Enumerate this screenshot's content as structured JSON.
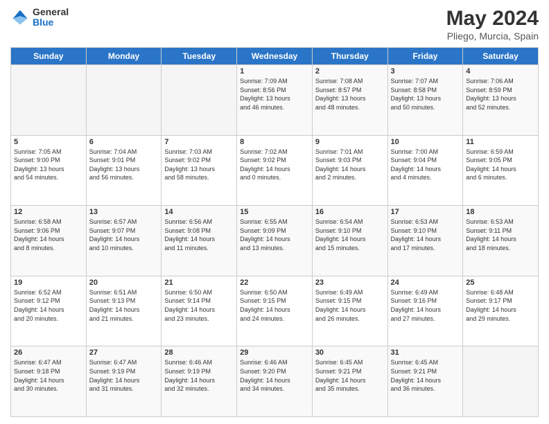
{
  "logo": {
    "general": "General",
    "blue": "Blue"
  },
  "header": {
    "title": "May 2024",
    "subtitle": "Pliego, Murcia, Spain"
  },
  "weekdays": [
    "Sunday",
    "Monday",
    "Tuesday",
    "Wednesday",
    "Thursday",
    "Friday",
    "Saturday"
  ],
  "weeks": [
    [
      {
        "day": "",
        "info": ""
      },
      {
        "day": "",
        "info": ""
      },
      {
        "day": "",
        "info": ""
      },
      {
        "day": "1",
        "info": "Sunrise: 7:09 AM\nSunset: 8:56 PM\nDaylight: 13 hours\nand 46 minutes."
      },
      {
        "day": "2",
        "info": "Sunrise: 7:08 AM\nSunset: 8:57 PM\nDaylight: 13 hours\nand 48 minutes."
      },
      {
        "day": "3",
        "info": "Sunrise: 7:07 AM\nSunset: 8:58 PM\nDaylight: 13 hours\nand 50 minutes."
      },
      {
        "day": "4",
        "info": "Sunrise: 7:06 AM\nSunset: 8:59 PM\nDaylight: 13 hours\nand 52 minutes."
      }
    ],
    [
      {
        "day": "5",
        "info": "Sunrise: 7:05 AM\nSunset: 9:00 PM\nDaylight: 13 hours\nand 54 minutes."
      },
      {
        "day": "6",
        "info": "Sunrise: 7:04 AM\nSunset: 9:01 PM\nDaylight: 13 hours\nand 56 minutes."
      },
      {
        "day": "7",
        "info": "Sunrise: 7:03 AM\nSunset: 9:02 PM\nDaylight: 13 hours\nand 58 minutes."
      },
      {
        "day": "8",
        "info": "Sunrise: 7:02 AM\nSunset: 9:02 PM\nDaylight: 14 hours\nand 0 minutes."
      },
      {
        "day": "9",
        "info": "Sunrise: 7:01 AM\nSunset: 9:03 PM\nDaylight: 14 hours\nand 2 minutes."
      },
      {
        "day": "10",
        "info": "Sunrise: 7:00 AM\nSunset: 9:04 PM\nDaylight: 14 hours\nand 4 minutes."
      },
      {
        "day": "11",
        "info": "Sunrise: 6:59 AM\nSunset: 9:05 PM\nDaylight: 14 hours\nand 6 minutes."
      }
    ],
    [
      {
        "day": "12",
        "info": "Sunrise: 6:58 AM\nSunset: 9:06 PM\nDaylight: 14 hours\nand 8 minutes."
      },
      {
        "day": "13",
        "info": "Sunrise: 6:57 AM\nSunset: 9:07 PM\nDaylight: 14 hours\nand 10 minutes."
      },
      {
        "day": "14",
        "info": "Sunrise: 6:56 AM\nSunset: 9:08 PM\nDaylight: 14 hours\nand 11 minutes."
      },
      {
        "day": "15",
        "info": "Sunrise: 6:55 AM\nSunset: 9:09 PM\nDaylight: 14 hours\nand 13 minutes."
      },
      {
        "day": "16",
        "info": "Sunrise: 6:54 AM\nSunset: 9:10 PM\nDaylight: 14 hours\nand 15 minutes."
      },
      {
        "day": "17",
        "info": "Sunrise: 6:53 AM\nSunset: 9:10 PM\nDaylight: 14 hours\nand 17 minutes."
      },
      {
        "day": "18",
        "info": "Sunrise: 6:53 AM\nSunset: 9:11 PM\nDaylight: 14 hours\nand 18 minutes."
      }
    ],
    [
      {
        "day": "19",
        "info": "Sunrise: 6:52 AM\nSunset: 9:12 PM\nDaylight: 14 hours\nand 20 minutes."
      },
      {
        "day": "20",
        "info": "Sunrise: 6:51 AM\nSunset: 9:13 PM\nDaylight: 14 hours\nand 21 minutes."
      },
      {
        "day": "21",
        "info": "Sunrise: 6:50 AM\nSunset: 9:14 PM\nDaylight: 14 hours\nand 23 minutes."
      },
      {
        "day": "22",
        "info": "Sunrise: 6:50 AM\nSunset: 9:15 PM\nDaylight: 14 hours\nand 24 minutes."
      },
      {
        "day": "23",
        "info": "Sunrise: 6:49 AM\nSunset: 9:15 PM\nDaylight: 14 hours\nand 26 minutes."
      },
      {
        "day": "24",
        "info": "Sunrise: 6:49 AM\nSunset: 9:16 PM\nDaylight: 14 hours\nand 27 minutes."
      },
      {
        "day": "25",
        "info": "Sunrise: 6:48 AM\nSunset: 9:17 PM\nDaylight: 14 hours\nand 29 minutes."
      }
    ],
    [
      {
        "day": "26",
        "info": "Sunrise: 6:47 AM\nSunset: 9:18 PM\nDaylight: 14 hours\nand 30 minutes."
      },
      {
        "day": "27",
        "info": "Sunrise: 6:47 AM\nSunset: 9:19 PM\nDaylight: 14 hours\nand 31 minutes."
      },
      {
        "day": "28",
        "info": "Sunrise: 6:46 AM\nSunset: 9:19 PM\nDaylight: 14 hours\nand 32 minutes."
      },
      {
        "day": "29",
        "info": "Sunrise: 6:46 AM\nSunset: 9:20 PM\nDaylight: 14 hours\nand 34 minutes."
      },
      {
        "day": "30",
        "info": "Sunrise: 6:45 AM\nSunset: 9:21 PM\nDaylight: 14 hours\nand 35 minutes."
      },
      {
        "day": "31",
        "info": "Sunrise: 6:45 AM\nSunset: 9:21 PM\nDaylight: 14 hours\nand 36 minutes."
      },
      {
        "day": "",
        "info": ""
      }
    ]
  ]
}
